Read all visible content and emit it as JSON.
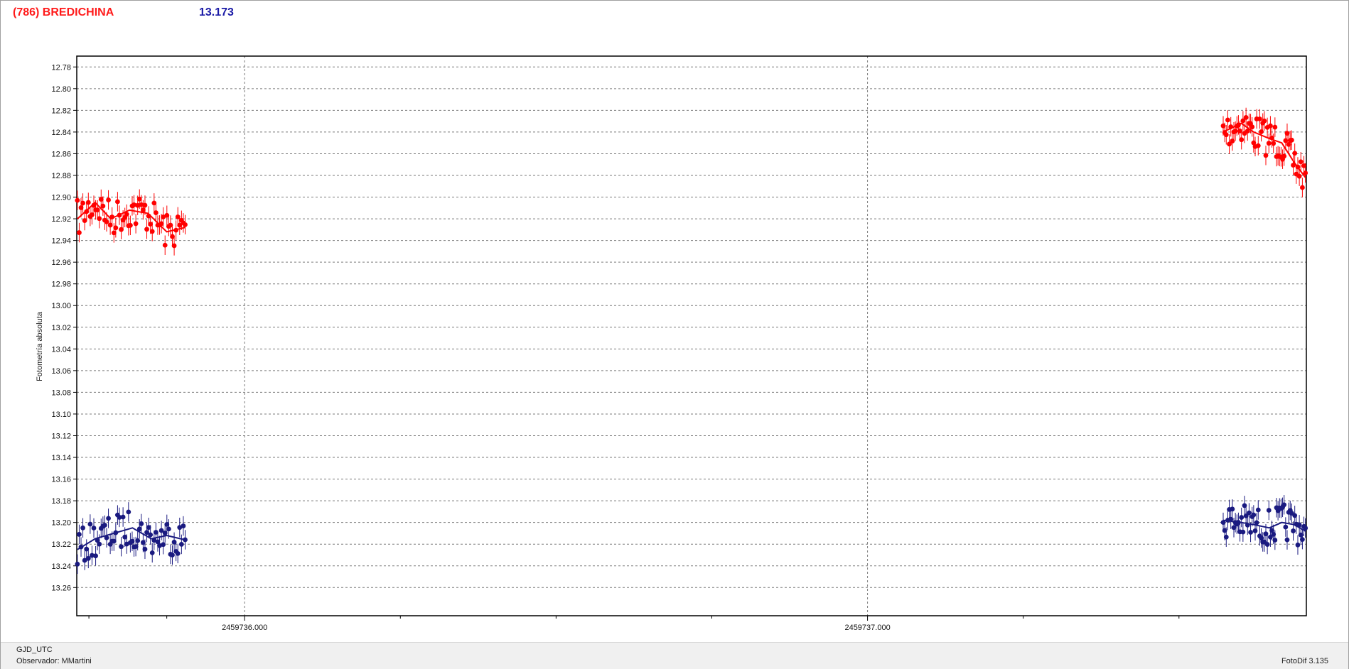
{
  "window": {
    "object_name": "(786) BREDICHINA",
    "reference_value": "13.173",
    "title_color": "#ff1a1a",
    "value_color": "#1a1aa6"
  },
  "footer": {
    "x_axis_name": "GJD_UTC",
    "observer": "Observador: MMartini",
    "software": "FotoDif 3.135"
  },
  "chart_data": {
    "type": "scatter",
    "ylabel": "Fotometría absoluta",
    "xlabel": "GJD_UTC",
    "y_inverted": true,
    "ylim": [
      12.77,
      13.286
    ],
    "xlim": [
      2459735.7305,
      2459737.7045
    ],
    "y_ticks": [
      12.78,
      12.8,
      12.82,
      12.84,
      12.86,
      12.88,
      12.9,
      12.92,
      12.94,
      12.96,
      12.98,
      13.0,
      13.02,
      13.04,
      13.06,
      13.08,
      13.1,
      13.12,
      13.14,
      13.16,
      13.18,
      13.2,
      13.22,
      13.24,
      13.26
    ],
    "x_labeled_ticks": [
      {
        "value": 2459736.0,
        "label": "2459736.000"
      },
      {
        "value": 2459737.0,
        "label": "2459737.000"
      }
    ],
    "x_minor_ticks": [
      2459735.75,
      2459735.875,
      2459736.25,
      2459736.5,
      2459736.75,
      2459737.25,
      2459737.5
    ],
    "grid": true,
    "series": [
      {
        "color": "#ff0000",
        "error_bar": 0.009,
        "segments": [
          {
            "x0": 2459735.7315,
            "x1": 2459735.9045,
            "n": 60,
            "curve": [
              [
                2459735.7315,
                12.92
              ],
              [
                2459735.76,
                12.905
              ],
              [
                2459735.785,
                12.92
              ],
              [
                2459735.815,
                12.912
              ],
              [
                2459735.845,
                12.915
              ],
              [
                2459735.875,
                12.932
              ],
              [
                2459735.9045,
                12.928
              ]
            ]
          },
          {
            "x0": 2459737.571,
            "x1": 2459737.703,
            "n": 55,
            "curve": [
              [
                2459737.571,
                12.84
              ],
              [
                2459737.6,
                12.832
              ],
              [
                2459737.62,
                12.84
              ],
              [
                2459737.645,
                12.846
              ],
              [
                2459737.665,
                12.85
              ],
              [
                2459737.685,
                12.868
              ],
              [
                2459737.703,
                12.882
              ]
            ]
          }
        ]
      },
      {
        "color": "#1a1a80",
        "error_bar": 0.009,
        "segments": [
          {
            "x0": 2459735.7315,
            "x1": 2459735.9045,
            "n": 60,
            "curve": [
              [
                2459735.7315,
                13.225
              ],
              [
                2459735.76,
                13.215
              ],
              [
                2459735.79,
                13.21
              ],
              [
                2459735.82,
                13.205
              ],
              [
                2459735.85,
                13.215
              ],
              [
                2459735.875,
                13.212
              ],
              [
                2459735.9045,
                13.216
              ]
            ]
          },
          {
            "x0": 2459737.571,
            "x1": 2459737.703,
            "n": 55,
            "curve": [
              [
                2459737.571,
                13.198
              ],
              [
                2459737.6,
                13.2
              ],
              [
                2459737.62,
                13.202
              ],
              [
                2459737.645,
                13.205
              ],
              [
                2459737.665,
                13.2
              ],
              [
                2459737.685,
                13.202
              ],
              [
                2459737.703,
                13.208
              ]
            ]
          }
        ]
      }
    ]
  }
}
